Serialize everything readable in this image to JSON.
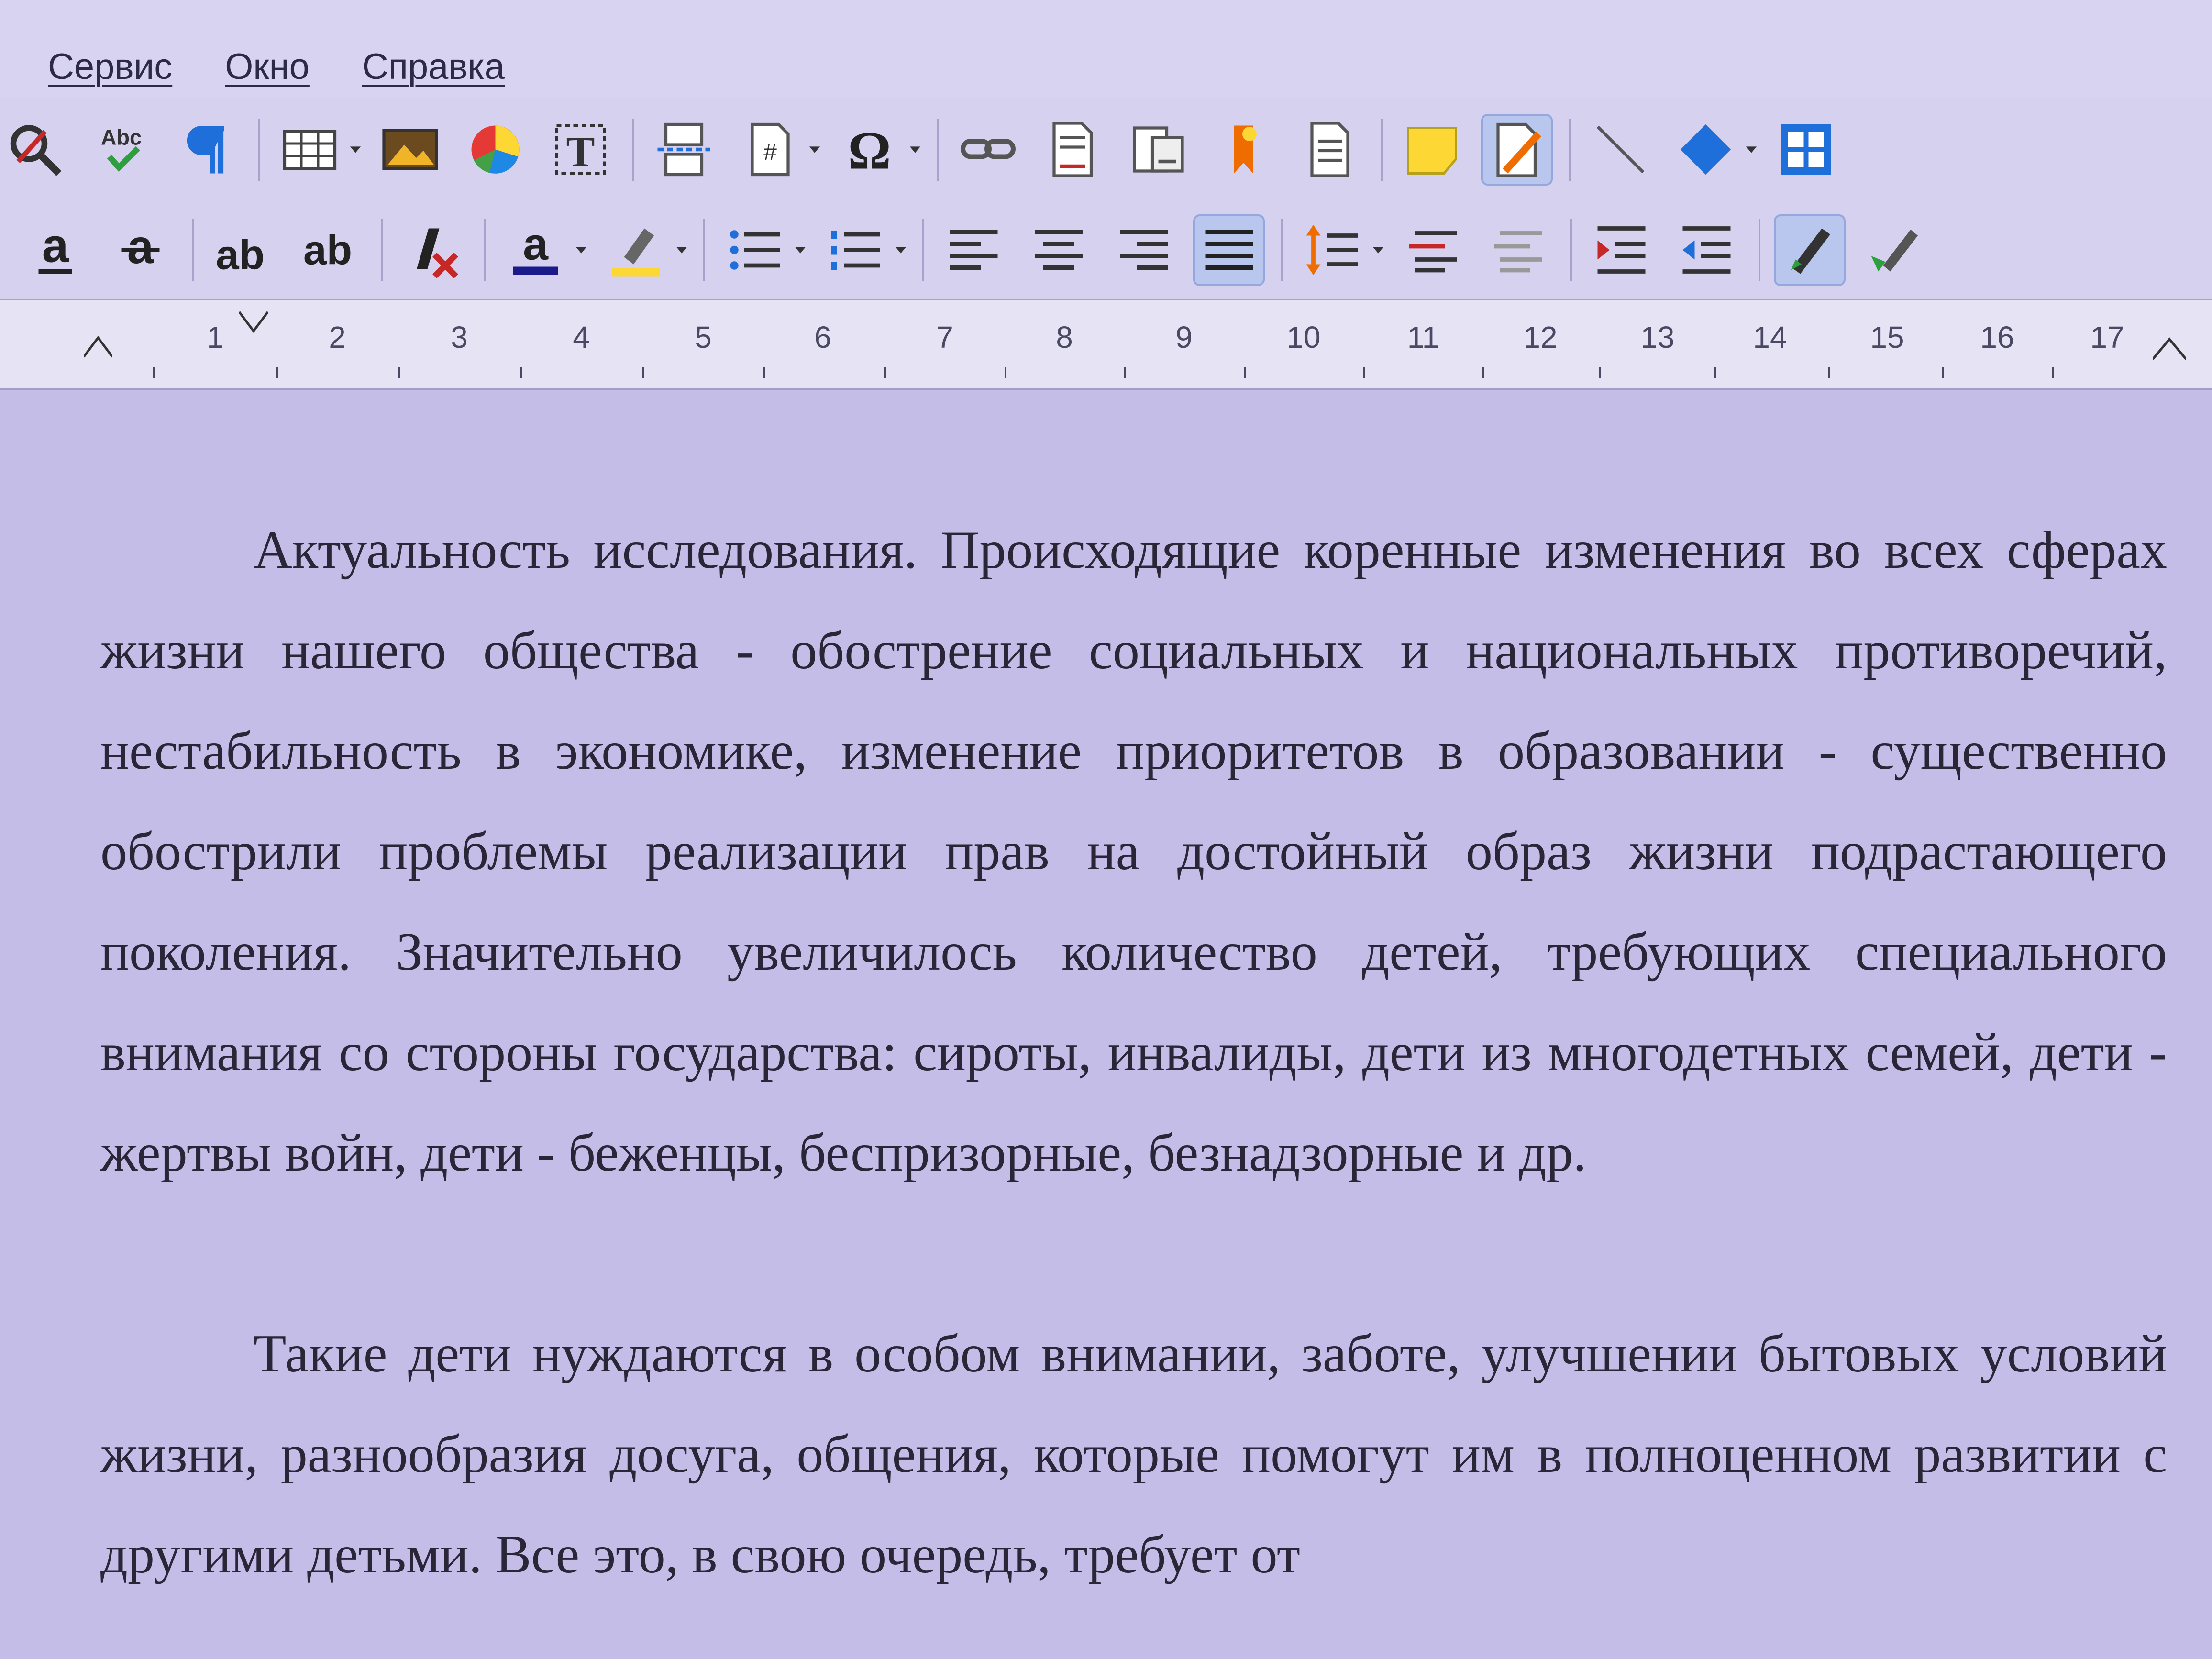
{
  "menu": {
    "items": [
      "Сервис",
      "Окно",
      "Справка"
    ]
  },
  "toolbar_standard": {
    "icons": [
      "find-replace-icon",
      "spellcheck-icon",
      "formatting-marks-icon",
      "insert-table-icon",
      "insert-image-icon",
      "insert-chart-icon",
      "insert-textbox-icon",
      "insert-page-break-icon",
      "insert-field-icon",
      "insert-special-character-icon",
      "insert-hyperlink-icon",
      "insert-footnote-icon",
      "insert-endnote-icon",
      "insert-bookmark-icon",
      "insert-cross-reference-icon",
      "insert-comment-icon",
      "track-changes-icon",
      "insert-line-icon",
      "basic-shapes-icon",
      "insert-frame-icon"
    ],
    "spellcheck_label": "Abc",
    "textbox_label": "T",
    "special_char_label": "Ω",
    "field_label": "#"
  },
  "toolbar_format": {
    "icons": [
      "underline-icon",
      "strikethrough-icon",
      "superscript-icon",
      "subscript-icon",
      "clear-formatting-icon",
      "font-color-icon",
      "highlight-color-icon",
      "bullet-list-icon",
      "numbered-list-icon",
      "align-left-icon",
      "align-center-icon",
      "align-right-icon",
      "justify-icon",
      "line-spacing-icon",
      "increase-paragraph-spacing-icon",
      "decrease-paragraph-spacing-icon",
      "increase-indent-icon",
      "decrease-indent-icon",
      "pen-tool-icon",
      "pen-tool-2-icon"
    ],
    "underline_label": "a",
    "strike_label": "a",
    "superscript_label": "ab",
    "subscript_label": "ab",
    "font_color_label": "a"
  },
  "ruler": {
    "numbers": [
      "1",
      "2",
      "3",
      "4",
      "5",
      "6",
      "7",
      "8",
      "9",
      "10",
      "11",
      "12",
      "13",
      "14",
      "15",
      "16",
      "17"
    ]
  },
  "document": {
    "paragraph_1": "Актуальность исследования. Происходящие коренные изменения во всех сферах жизни нашего общества - обострение социальных и национальных противоречий, нестабильность в экономике, изменение приоритетов в образовании - существенно обострили проблемы реализации прав на достойный образ жизни подрастающего поколения. Значительно увеличилось количество детей, требующих специального внимания со стороны государства: сироты, инвалиды, дети из многодетных семей, дети - жертвы войн, дети - беженцы, беспризорные, безнадзорные и др.",
    "paragraph_2": "Такие дети нуждаются в особом внимании, заботе, улучшении бытовых условий жизни, разнообразия досуга, общения, которые помогут им в полноценном развитии с другими детьми. Все это, в свою очередь, требует от"
  },
  "colors": {
    "accent_blue": "#1e6fd9",
    "active_tool_bg": "#b9c7ee",
    "document_bg": "#c3bde7"
  }
}
